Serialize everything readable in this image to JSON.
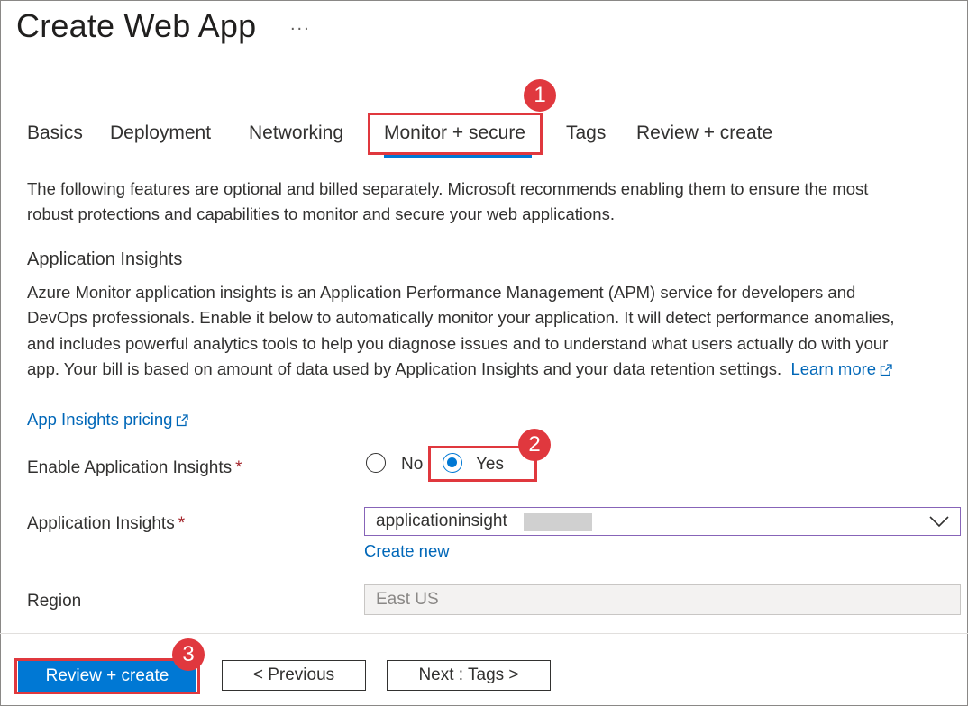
{
  "page": {
    "title": "Create Web App",
    "more_label": "..."
  },
  "tabs": [
    {
      "label": "Basics",
      "selected": false
    },
    {
      "label": "Deployment",
      "selected": false
    },
    {
      "label": "Networking",
      "selected": false
    },
    {
      "label": "Monitor + secure",
      "selected": true
    },
    {
      "label": "Tags",
      "selected": false
    },
    {
      "label": "Review + create",
      "selected": false
    }
  ],
  "intro": {
    "line1": "The following features are optional and billed separately. Microsoft recommends enabling them to ensure the most",
    "line2": "robust protections and capabilities to monitor and secure your web applications."
  },
  "app_insights": {
    "heading": "Application Insights",
    "desc_line1": "Azure Monitor application insights is an Application Performance Management (APM) service for developers and",
    "desc_line2": "DevOps professionals. Enable it below to automatically monitor your application. It will detect performance anomalies,",
    "desc_line3": "and includes powerful analytics tools to help you diagnose issues and to understand what users actually do with your",
    "desc_line4": "app. Your bill is based on amount of data used by Application Insights and your data retention settings.",
    "learn_more": "Learn more",
    "pricing_link": "App Insights pricing"
  },
  "form": {
    "enable_label": "Enable Application Insights",
    "required_mark": "*",
    "option_no": "No",
    "option_yes": "Yes",
    "selected_option": "Yes",
    "insights_label": "Application Insights",
    "insights_value": "applicationinsight",
    "create_new": "Create new",
    "region_label": "Region",
    "region_value": "East US"
  },
  "footer": {
    "review_create": "Review + create",
    "previous": "< Previous",
    "next": "Next : Tags >"
  },
  "callouts": {
    "one": "1",
    "two": "2",
    "three": "3"
  },
  "colors": {
    "accent": "#0078d4",
    "link": "#0067b8",
    "callout": "#e0383e",
    "required": "#a4262c"
  }
}
